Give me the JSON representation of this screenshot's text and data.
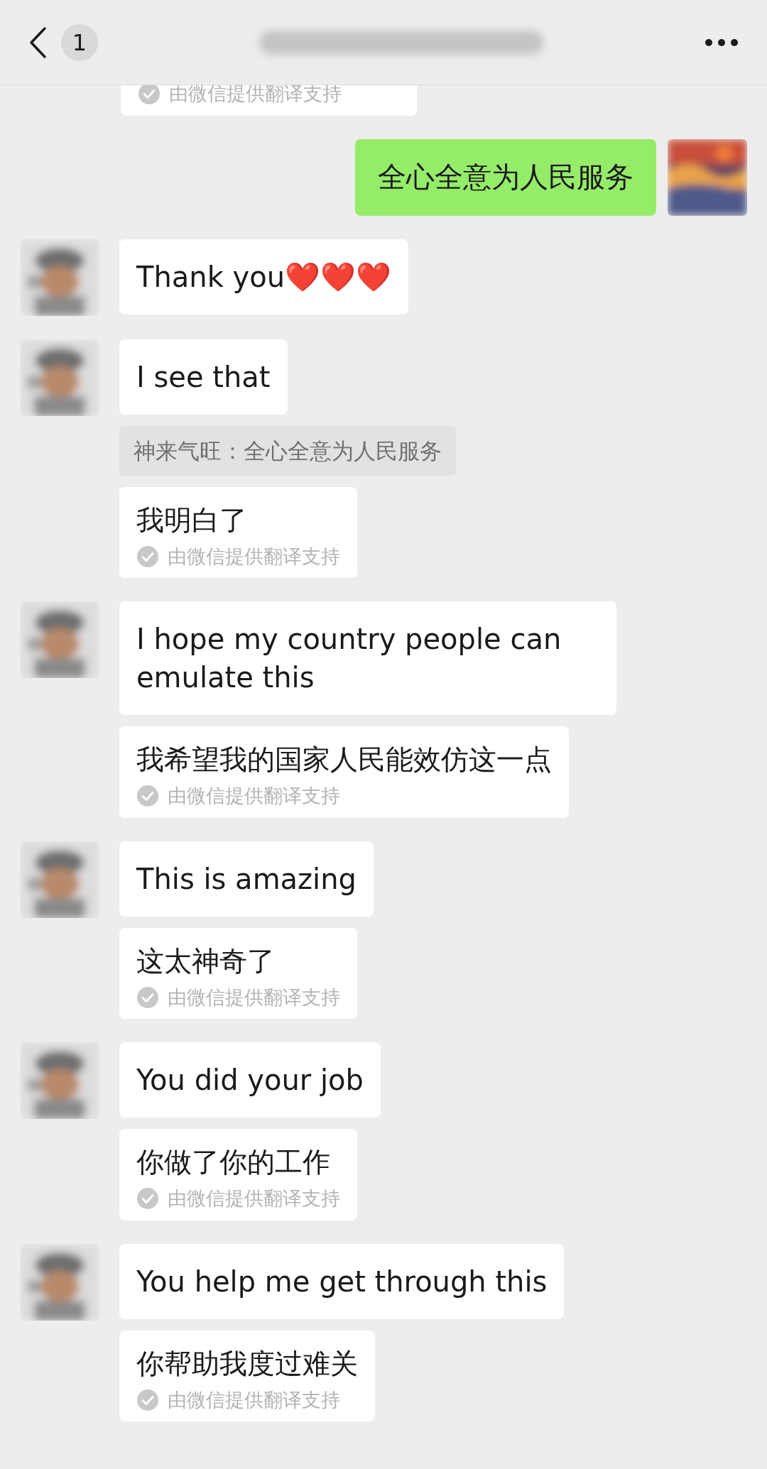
{
  "header": {
    "unread_count": "1"
  },
  "messages": [
    {
      "kind": "translation_tail",
      "caption": "由微信提供翻译支持"
    },
    {
      "kind": "outgoing",
      "text": "全心全意为人民服务"
    },
    {
      "kind": "incoming",
      "bubbles": [
        {
          "kind": "text",
          "text": "Thank you❤️❤️❤️"
        }
      ]
    },
    {
      "kind": "incoming",
      "bubbles": [
        {
          "kind": "text",
          "text": "I see that"
        },
        {
          "kind": "quote",
          "text": "神来气旺：全心全意为人民服务"
        },
        {
          "kind": "translation",
          "text": "我明白了",
          "caption": "由微信提供翻译支持"
        }
      ]
    },
    {
      "kind": "incoming",
      "bubbles": [
        {
          "kind": "text",
          "text": "I hope my country people can emulate this"
        },
        {
          "kind": "translation",
          "text": "我希望我的国家人民能效仿这一点",
          "caption": "由微信提供翻译支持"
        }
      ]
    },
    {
      "kind": "incoming",
      "bubbles": [
        {
          "kind": "text",
          "text": "This is amazing"
        },
        {
          "kind": "translation",
          "text": "这太神奇了",
          "caption": "由微信提供翻译支持"
        }
      ]
    },
    {
      "kind": "incoming",
      "bubbles": [
        {
          "kind": "text",
          "text": "You did your job"
        },
        {
          "kind": "translation",
          "text": "你做了你的工作",
          "caption": "由微信提供翻译支持"
        }
      ]
    },
    {
      "kind": "incoming",
      "bubbles": [
        {
          "kind": "text",
          "text": "You help me get through this"
        },
        {
          "kind": "translation",
          "text": "你帮助我度过难关",
          "caption": "由微信提供翻译支持"
        }
      ]
    }
  ]
}
